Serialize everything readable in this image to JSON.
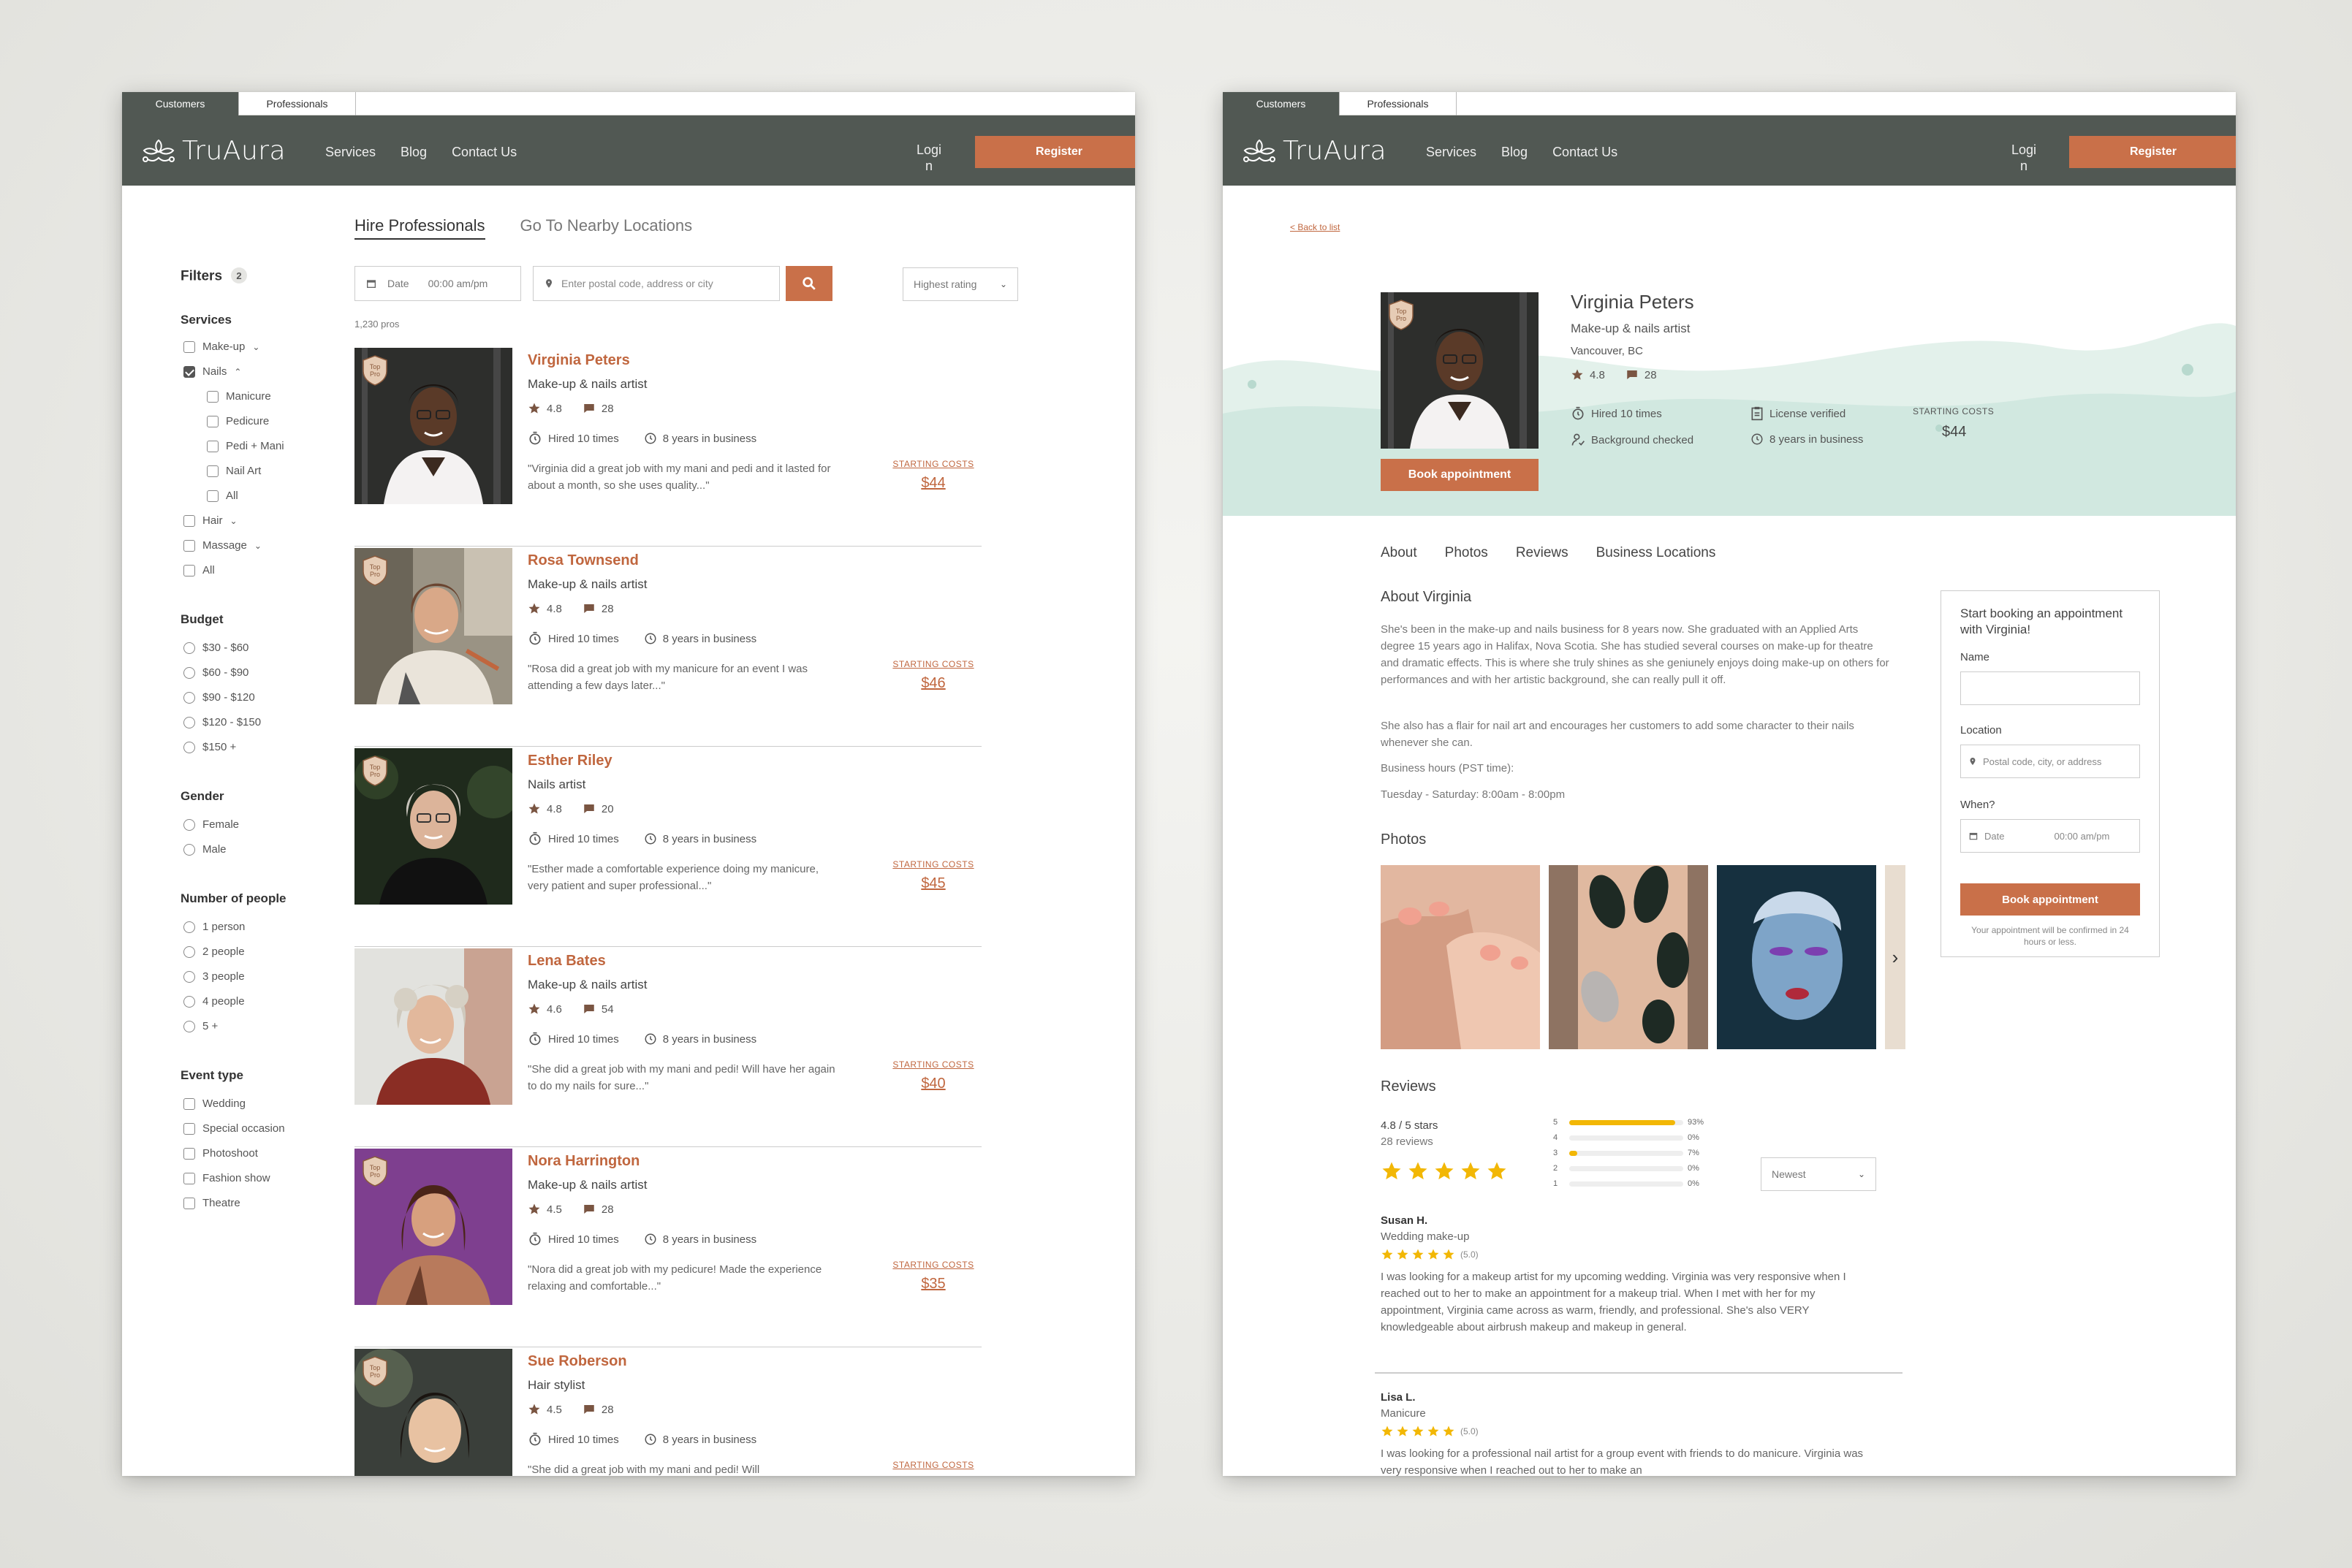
{
  "brand": "TruAura",
  "tabs": [
    "Customers",
    "Professionals"
  ],
  "nav": [
    "Services",
    "Blog",
    "Contact Us"
  ],
  "login": "Login",
  "register": "Register",
  "colors": {
    "header": "#515853",
    "accent": "#c97049",
    "star": "#f2b705"
  },
  "list": {
    "tab_hire": "Hire Professionals",
    "tab_nearby": "Go To Nearby Locations",
    "filters": {
      "title": "Filters",
      "count": "2"
    },
    "services": {
      "title": "Services",
      "items": [
        "Make-up",
        "Nails",
        "Manicure",
        "Pedicure",
        "Pedi + Mani",
        "Nail Art",
        "All",
        "Hair",
        "Massage",
        "All"
      ]
    },
    "budget": {
      "title": "Budget",
      "items": [
        "$30 - $60",
        "$60 - $90",
        "$90 - $120",
        "$120 - $150",
        "$150 +"
      ]
    },
    "gender": {
      "title": "Gender",
      "items": [
        "Female",
        "Male"
      ]
    },
    "people": {
      "title": "Number of people",
      "items": [
        "1 person",
        "2 people",
        "3 people",
        "4 people",
        "5 +"
      ]
    },
    "event": {
      "title": "Event type",
      "items": [
        "Wedding",
        "Special occasion",
        "Photoshoot",
        "Fashion show",
        "Theatre"
      ]
    },
    "search": {
      "date": "Date",
      "time": "00:00 am/pm",
      "location_placeholder": "Enter postal code, address or city",
      "sort": "Highest rating"
    },
    "count": "1,230 pros",
    "badge_text": "Top Pro",
    "starting_costs": "STARTING COSTS",
    "pros": [
      {
        "name": "Virginia Peters",
        "role": "Make-up & nails artist",
        "rating": "4.8",
        "reviews": "28",
        "hired": "Hired 10 times",
        "years": "8 years in business",
        "quote": "\"Virginia did a great job with my mani and pedi and it lasted for about a month, so she uses quality...\"",
        "price": "$44"
      },
      {
        "name": "Rosa Townsend",
        "role": "Make-up & nails artist",
        "rating": "4.8",
        "reviews": "28",
        "hired": "Hired 10 times",
        "years": "8 years in business",
        "quote": "\"Rosa did a great job with my manicure for an event I was attending a few days later...\"",
        "price": "$46"
      },
      {
        "name": "Esther Riley",
        "role": "Nails artist",
        "rating": "4.8",
        "reviews": "20",
        "hired": "Hired 10 times",
        "years": "8 years in business",
        "quote": "\"Esther made a comfortable experience doing my manicure, very patient and super professional...\"",
        "price": "$45"
      },
      {
        "name": "Lena Bates",
        "role": "Make-up & nails artist",
        "rating": "4.6",
        "reviews": "54",
        "hired": "Hired 10 times",
        "years": "8 years in business",
        "quote": "\"She did a great job with my mani and pedi! Will have her again to do my nails for sure...\"",
        "price": "$40"
      },
      {
        "name": "Nora Harrington",
        "role": "Make-up & nails artist",
        "rating": "4.5",
        "reviews": "28",
        "hired": "Hired 10 times",
        "years": "8 years in business",
        "quote": "\"Nora did a great job with my pedicure! Made the experience relaxing and comfortable...\"",
        "price": "$35"
      },
      {
        "name": "Sue Roberson",
        "role": "Hair stylist",
        "rating": "4.5",
        "reviews": "28",
        "hired": "Hired 10 times",
        "years": "8 years in business",
        "quote": "\"She did a great job with my mani and pedi! Will",
        "price": ""
      }
    ]
  },
  "profile": {
    "back": "< Back to list",
    "name": "Virginia Peters",
    "role": "Make-up & nails artist",
    "location": "Vancouver, BC",
    "rating": "4.8",
    "reviews": "28",
    "hired": "Hired 10 times",
    "license": "License verified",
    "background": "Background checked",
    "years": "8 years in business",
    "starting_label": "STARTING COSTS",
    "price": "$44",
    "book": "Book appointment",
    "tabs": [
      "About",
      "Photos",
      "Reviews",
      "Business Locations"
    ],
    "about_title": "About Virginia",
    "about_p1": "She's been in the make-up and nails business for 8 years now. She graduated with an Applied Arts degree 15 years ago in Halifax, Nova Scotia. She has studied several courses on make-up for theatre and dramatic effects. This is where she truly shines as she geniunely enjoys doing make-up on others for performances and with her artistic background, she can really pull it off.",
    "about_p2": "She also has a flair for nail art and encourages her customers to add some character to their nails whenever she can.",
    "hours_label": "Business hours (PST time):",
    "hours": "Tuesday - Saturday: 8:00am - 8:00pm",
    "photos_title": "Photos",
    "reviews_title": "Reviews",
    "score": "4.8 / 5 stars",
    "review_count": "28 reviews",
    "dist": [
      {
        "label": "5",
        "pct": "93%",
        "frac": 0.93
      },
      {
        "label": "4",
        "pct": "0%",
        "frac": 0
      },
      {
        "label": "3",
        "pct": "7%",
        "frac": 0.07
      },
      {
        "label": "2",
        "pct": "0%",
        "frac": 0
      },
      {
        "label": "1",
        "pct": "0%",
        "frac": 0
      }
    ],
    "sort": "Newest",
    "review_list": [
      {
        "name": "Susan H.",
        "type": "Wedding make-up",
        "score": "(5.0)",
        "text": "I was looking for a makeup artist for my upcoming wedding. Virginia was very responsive when I reached out to her to make an appointment for a makeup trial. When I met with her for my appointment, Virginia came across as warm, friendly, and professional. She's also VERY knowledgeable about airbrush makeup and makeup in general."
      },
      {
        "name": "Lisa L.",
        "type": "Manicure",
        "score": "(5.0)",
        "text": "I was looking for a professional nail artist for a group event with friends to do manicure. Virginia was very responsive when I reached out to her to make an"
      }
    ],
    "booking": {
      "title": "Start booking an appointment with Virginia!",
      "name_label": "Name",
      "loc_label": "Location",
      "loc_placeholder": "Postal code, city, or address",
      "when_label": "When?",
      "date": "Date",
      "time": "00:00 am/pm",
      "button": "Book appointment",
      "note": "Your appointment will be confirmed in 24 hours or less."
    }
  }
}
